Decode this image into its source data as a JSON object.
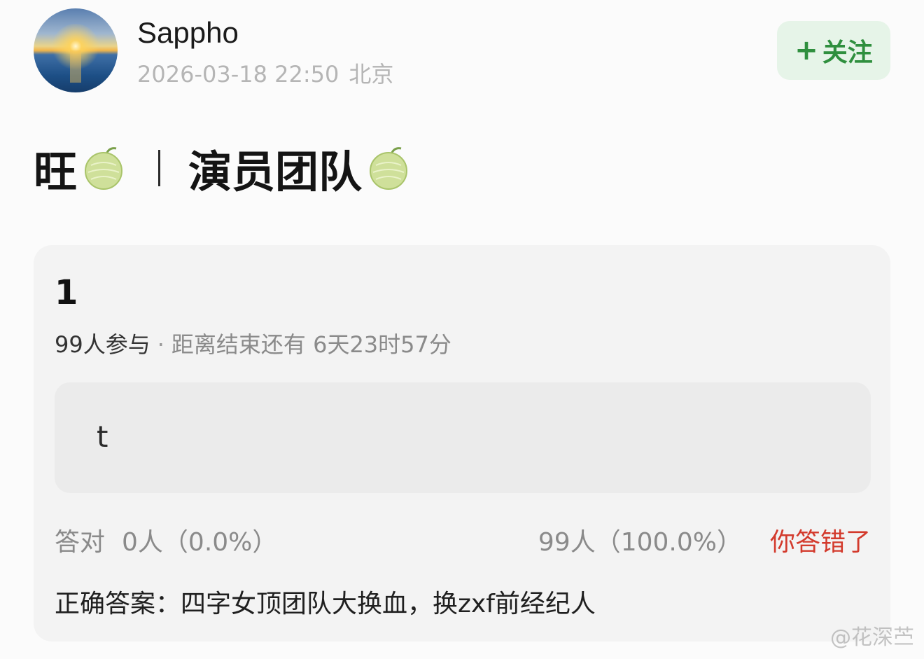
{
  "header": {
    "username": "Sappho",
    "timestamp": "2026-03-18 22:50",
    "location": "北京",
    "follow_plus": "+",
    "follow_label": "关注"
  },
  "post": {
    "title_part1": "旺",
    "title_part2": "演员团队",
    "title_emoji": "melon"
  },
  "quiz": {
    "title": "1",
    "participants": "99人参与",
    "separator": "·",
    "deadline": "距离结束还有 6天23时57分",
    "option_text": "t",
    "correct_label": "答对",
    "correct_count": "0人（0.0%）",
    "wrong_count": "99人（100.0%）",
    "result": "你答错了",
    "answer": "正确答案：四字女顶团队大换血，换zxf前经纪人"
  },
  "watermark": "@花深苎",
  "colors": {
    "follow_bg": "#e6f4e8",
    "follow_text": "#2f8f3e",
    "wrong_text": "#d33a2c",
    "card_bg": "#f3f3f3"
  }
}
